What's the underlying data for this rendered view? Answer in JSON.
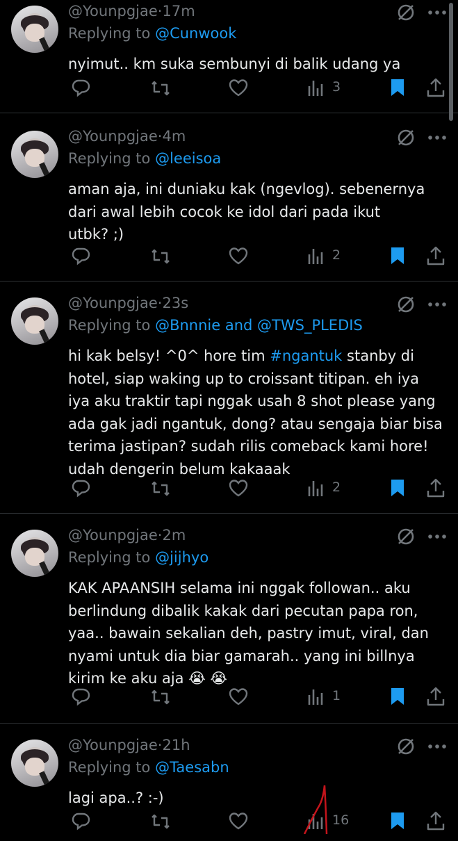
{
  "tweets": [
    {
      "handle": "@Younpgjae",
      "sep": "·",
      "time": "17m",
      "replying_prefix": "Replying to",
      "replying_to": [
        {
          "text": "@Cunwook"
        }
      ],
      "lines": [
        "nyimut.. km suka sembunyi di balik udang ya"
      ],
      "views": "3"
    },
    {
      "handle": "@Younpgjae",
      "sep": "·",
      "time": "4m",
      "replying_prefix": "Replying to",
      "replying_to": [
        {
          "text": "@leeisoa"
        }
      ],
      "lines": [
        "aman aja, ini duniaku kak (ngevlog). sebenernya",
        "dari awal lebih cocok ke idol dari pada ikut",
        "utbk? ;)"
      ],
      "views": "2"
    },
    {
      "handle": "@Younpgjae",
      "sep": "·",
      "time": "23s",
      "replying_prefix": "Replying to",
      "replying_to": [
        {
          "text": "@Bnnnie and @TWS_PLEDIS"
        }
      ],
      "lines_rich": [
        [
          {
            "t": "hi kak belsy! ^0^ hore tim "
          },
          {
            "t": "#ngantuk",
            "link": true
          },
          {
            "t": " stanby di"
          }
        ],
        [
          {
            "t": "hotel, siap waking up to croissant titipan. eh iya"
          }
        ],
        [
          {
            "t": "iya aku traktir tapi nggak usah 8 shot please yang"
          }
        ],
        [
          {
            "t": "ada gak jadi ngantuk, dong? atau sengaja biar bisa"
          }
        ],
        [
          {
            "t": "terima jastipan? sudah rilis comeback kami hore!"
          }
        ],
        [
          {
            "t": "udah dengerin belum kakaaak"
          }
        ]
      ],
      "views": "2"
    },
    {
      "handle": "@Younpgjae",
      "sep": "·",
      "time": "2m",
      "replying_prefix": "Replying to",
      "replying_to": [
        {
          "text": "@jijhyo"
        }
      ],
      "lines": [
        "KAK APAANSIH selama ini nggak followan.. aku",
        "berlindung dibalik kakak dari pecutan papa ron,",
        "yaa.. bawain sekalian deh, pastry imut, viral, dan",
        "nyami untuk dia biar gamarah.. yang ini billnya",
        "kirim ke aku aja 😭 😭"
      ],
      "views": "1"
    },
    {
      "handle": "@Younpgjae",
      "sep": "·",
      "time": "21h",
      "replying_prefix": "Replying to",
      "replying_to": [
        {
          "text": "@Taesabn"
        }
      ],
      "lines": [
        "lagi apa..? :-)"
      ],
      "views": "16"
    }
  ],
  "icons": {
    "reply": "reply-icon",
    "repost": "repost-icon",
    "like": "like-icon",
    "views": "views-icon",
    "bookmark": "bookmark-icon",
    "share": "share-icon",
    "grok": "grok-icon",
    "more": "more-icon"
  },
  "colors": {
    "background": "#000000",
    "text": "#e7e9ea",
    "muted": "#71767b",
    "accent": "#1d9bf0",
    "divider": "#2f3336"
  }
}
